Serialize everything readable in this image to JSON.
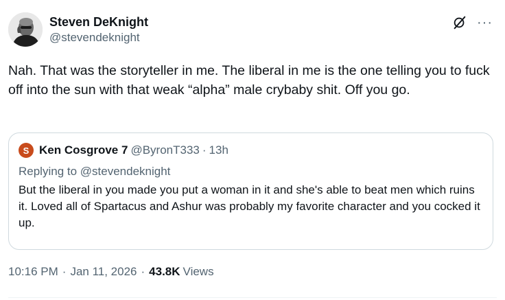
{
  "author": {
    "display_name": "Steven DeKnight",
    "handle": "@stevendeknight",
    "avatar_icon": "avatar-photo"
  },
  "header_icons": {
    "grok": "grok-icon",
    "more": "···"
  },
  "tweet": {
    "text": "Nah. That was the storyteller in me. The liberal in me is the one telling you to fuck off into the sun with that weak “alpha” male crybaby shit. Off you go."
  },
  "quote": {
    "avatar_letter": "S",
    "avatar_color": "#c84b1c",
    "display_name": "Ken Cosgrove 7",
    "handle": "@ByronT333",
    "separator": "·",
    "time": "13h",
    "replying_prefix": "Replying to ",
    "replying_handle": "@stevendeknight",
    "text": "But the liberal in you made you put a woman in it and she's able to beat  men which ruins it. Loved all of Spartacus and Ashur was probably my favorite character and you cocked it up."
  },
  "meta": {
    "time": "10:16 PM",
    "date": "Jan 11, 2026",
    "separator": "·",
    "views_count": "43.8K",
    "views_label": "Views"
  },
  "colors": {
    "text_primary": "#0f1419",
    "text_secondary": "#536471",
    "border": "#cfd9de"
  }
}
